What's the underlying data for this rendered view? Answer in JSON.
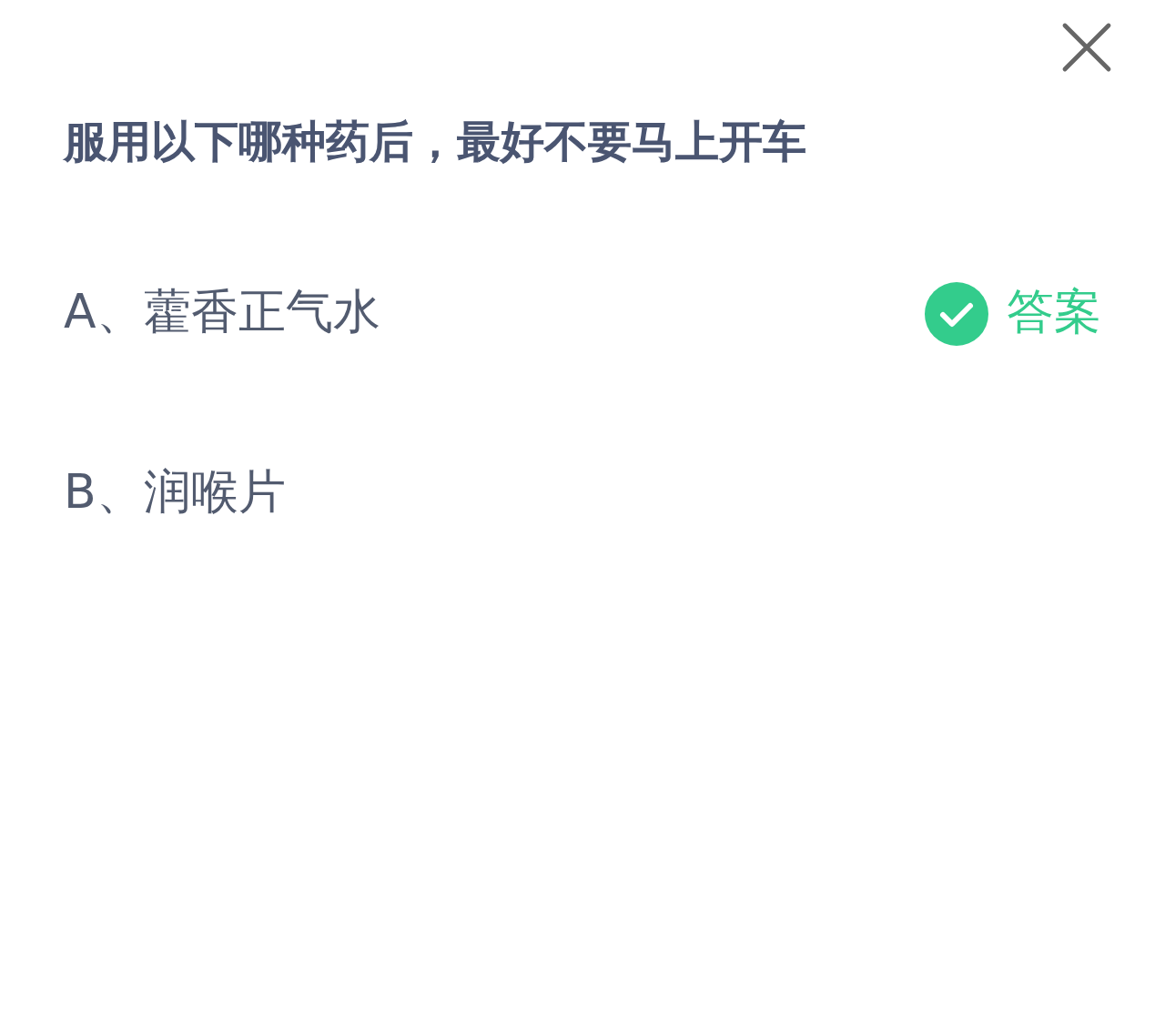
{
  "question": "服用以下哪种药后，最好不要马上开车",
  "options": [
    {
      "label": "A、藿香正气水",
      "correct": true,
      "answer_text": "答案"
    },
    {
      "label": "B、润喉片",
      "correct": false
    }
  ]
}
